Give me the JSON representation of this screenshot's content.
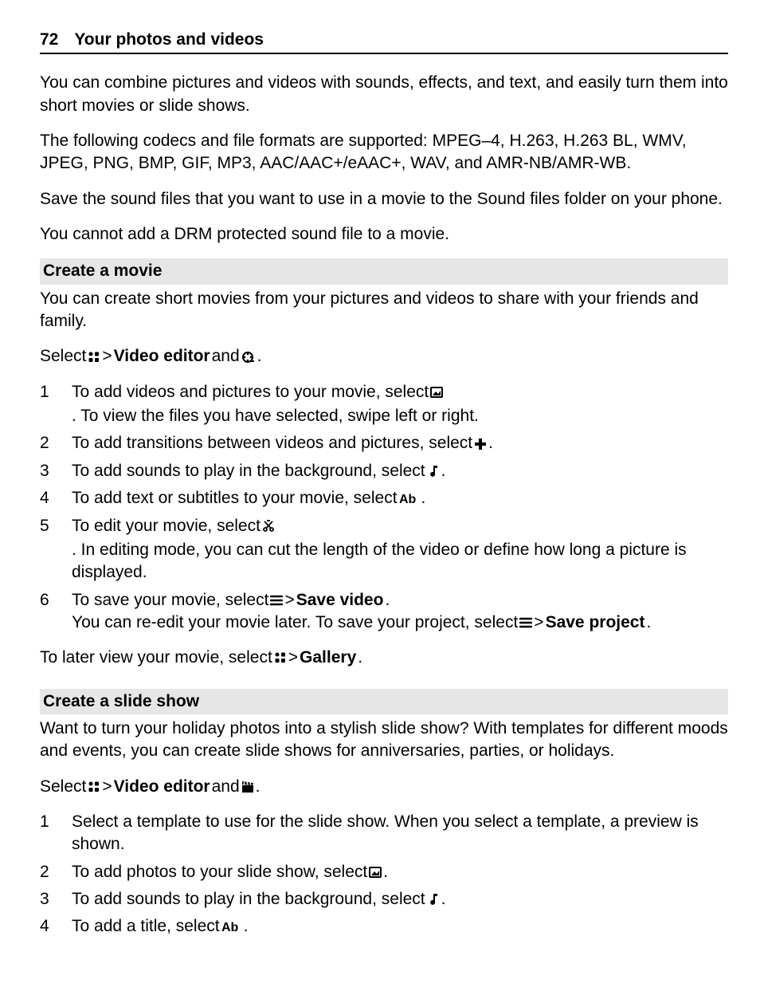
{
  "header": {
    "page_number": "72",
    "title": "Your photos and videos"
  },
  "intro": {
    "p1": "You can combine pictures and videos with sounds, effects, and text, and easily turn them into short movies or slide shows.",
    "p2": "The following codecs and file formats are supported: MPEG–4, H.263, H.263 BL, WMV, JPEG, PNG, BMP, GIF, MP3, AAC/AAC+/eAAC+, WAV, and AMR-NB/AMR-WB.",
    "p3": "Save the sound files that you want to use in a movie to the Sound files folder on your phone.",
    "p4": "You cannot add a DRM protected sound file to a movie."
  },
  "movie": {
    "heading": "Create a movie",
    "intro": "You can create short movies from your pictures and videos to share with your friends and family.",
    "select_line": {
      "a": "Select ",
      "b": " > ",
      "c": "Video editor",
      "d": " and ",
      "e": "."
    },
    "steps": {
      "s1a": "To add videos and pictures to your movie, select ",
      "s1b": ". To view the files you have selected, swipe left or right.",
      "s2a": "To add transitions between videos and pictures, select ",
      "s2b": ".",
      "s3a": "To add sounds to play in the background, select ",
      "s3b": ".",
      "s4a": "To add text or subtitles to your movie, select ",
      "s4b": ".",
      "s5a": "To edit your movie, select ",
      "s5b": ". In editing mode, you can cut the length of the video or define how long a picture is displayed.",
      "s6a": "To save your movie, select ",
      "s6b": " > ",
      "s6c": "Save video",
      "s6d": ".",
      "s6e": "You can re-edit your movie later. To save your project, select ",
      "s6f": " > ",
      "s6g": "Save project",
      "s6h": "."
    },
    "later": {
      "a": "To later view your movie, select ",
      "b": " > ",
      "c": "Gallery",
      "d": "."
    }
  },
  "slideshow": {
    "heading": "Create a slide show",
    "intro": "Want to turn your holiday photos into a stylish slide show? With templates for different moods and events, you can create slide shows for anniversaries, parties, or holidays.",
    "select_line": {
      "a": "Select ",
      "b": " > ",
      "c": "Video editor",
      "d": " and ",
      "e": "."
    },
    "steps": {
      "s1": "Select a template to use for the slide show. When you select a template, a preview is shown.",
      "s2a": "To add photos to your slide show, select ",
      "s2b": ".",
      "s3a": "To add sounds to play in the background, select ",
      "s3b": ".",
      "s4a": "To add a title, select ",
      "s4b": "."
    }
  },
  "nums": {
    "n1": "1",
    "n2": "2",
    "n3": "3",
    "n4": "4",
    "n5": "5",
    "n6": "6"
  }
}
